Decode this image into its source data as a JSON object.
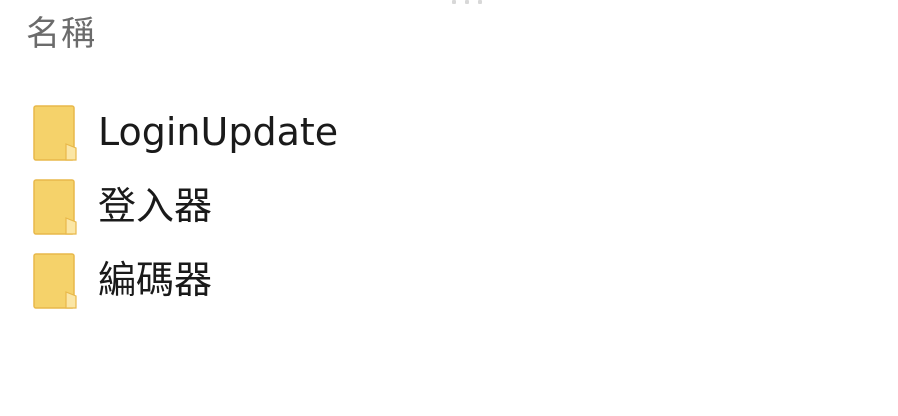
{
  "colors": {
    "folder_body": "#f5d26a",
    "folder_edge": "#e8b84a",
    "folder_fold": "#fbe6a5",
    "header_text": "#6b6b6b",
    "item_text": "#1a1a1a"
  },
  "header": {
    "name_column_label": "名稱"
  },
  "files": [
    {
      "name": "LoginUpdate",
      "icon": "folder-icon"
    },
    {
      "name": "登入器",
      "icon": "folder-icon"
    },
    {
      "name": "編碼器",
      "icon": "folder-icon"
    }
  ]
}
